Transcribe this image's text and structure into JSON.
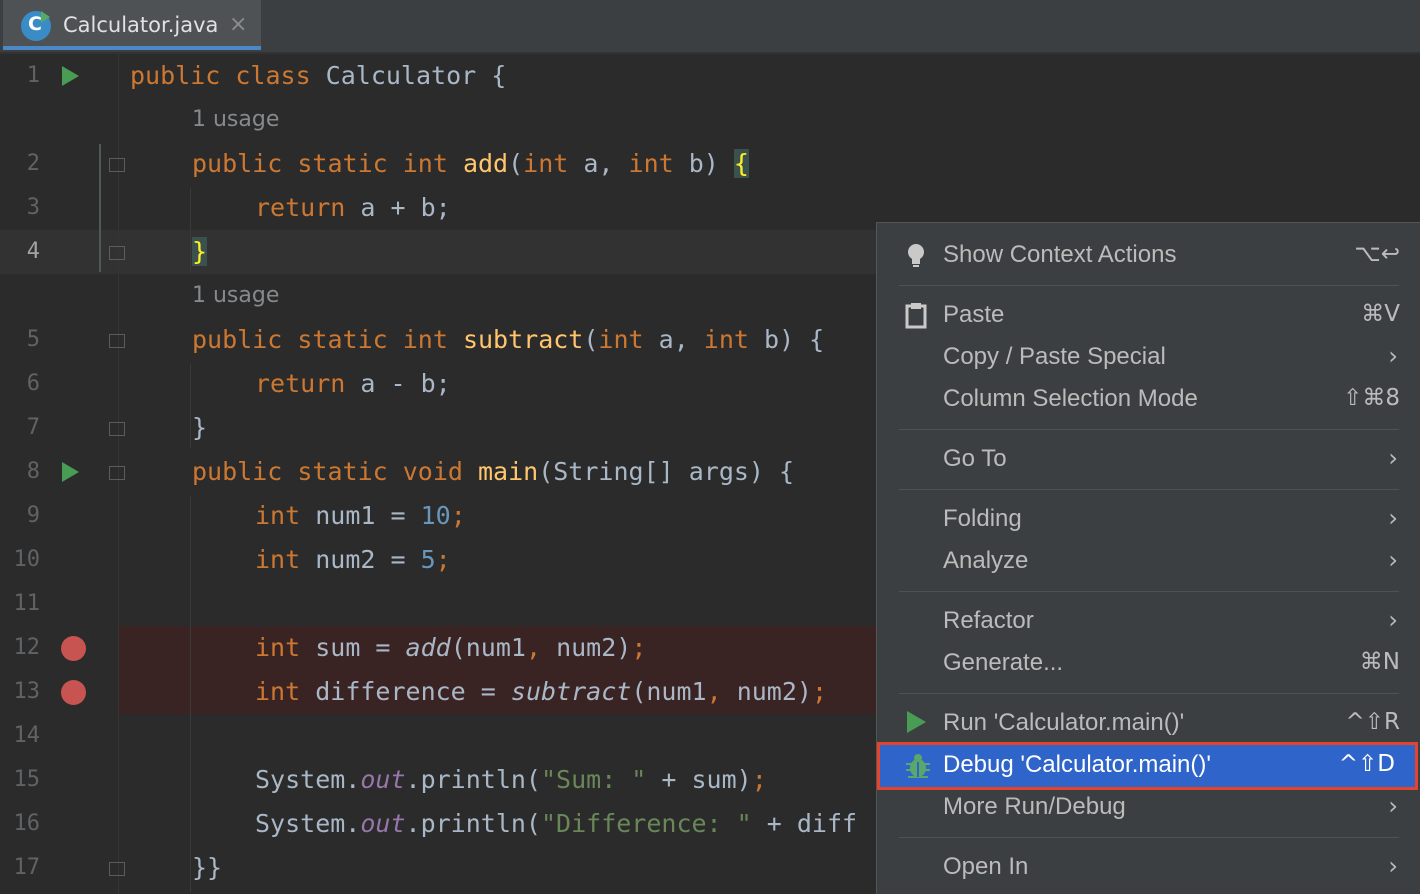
{
  "tab": {
    "title": "Calculator.java",
    "close": "×",
    "icon_letter": "C"
  },
  "usage_hint": "1 usage",
  "code_lines": [
    {
      "num": "1"
    },
    {
      "num": "2"
    },
    {
      "num": "3"
    },
    {
      "num": "4"
    },
    {
      "num": "5"
    },
    {
      "num": "6"
    },
    {
      "num": "7"
    },
    {
      "num": "8"
    },
    {
      "num": "9"
    },
    {
      "num": "10"
    },
    {
      "num": "11"
    },
    {
      "num": "12"
    },
    {
      "num": "13"
    },
    {
      "num": "14"
    },
    {
      "num": "15"
    },
    {
      "num": "16"
    },
    {
      "num": "17"
    }
  ],
  "code": {
    "l1": [
      "public",
      " class ",
      "Calculator {"
    ],
    "l2": [
      "public static int ",
      "add",
      "(",
      "int ",
      "a, ",
      "int ",
      "b) ",
      "{"
    ],
    "l3": [
      "return ",
      "a + b;"
    ],
    "l4": [
      "}"
    ],
    "l5": [
      "public static int ",
      "subtract",
      "(",
      "int ",
      "a, ",
      "int ",
      "b) {"
    ],
    "l6": [
      "return ",
      "a - b;"
    ],
    "l7": [
      "}"
    ],
    "l8": [
      "public static void ",
      "main",
      "(String[] args) {"
    ],
    "l9": [
      "int ",
      "num1 = ",
      "10",
      ";"
    ],
    "l10": [
      "int ",
      "num2 = ",
      "5",
      ";"
    ],
    "l12": [
      "int ",
      "sum = ",
      "add",
      "(num1",
      ", ",
      "num2)",
      ";"
    ],
    "l13": [
      "int ",
      "difference = ",
      "subtract",
      "(num1",
      ", ",
      "num2)",
      ";"
    ],
    "l15": [
      "System.",
      "out",
      ".println(",
      "\"Sum: \"",
      " + sum)",
      ";"
    ],
    "l16": [
      "System.",
      "out",
      ".println(",
      "\"Difference: \"",
      " + diff"
    ],
    "l17": [
      "}}"
    ]
  },
  "menu": {
    "items": [
      {
        "label": "Show Context Actions",
        "shortcut": "⌥↩",
        "icon": "lightbulb-icon"
      },
      {
        "label": "Paste",
        "shortcut": "⌘V",
        "icon": "clipboard-icon"
      },
      {
        "label": "Copy / Paste Special",
        "arrow": "›"
      },
      {
        "label": "Column Selection Mode",
        "shortcut": "⇧⌘8"
      },
      {
        "label": "Go To",
        "arrow": "›"
      },
      {
        "label": "Folding",
        "arrow": "›"
      },
      {
        "label": "Analyze",
        "arrow": "›"
      },
      {
        "label": "Refactor",
        "arrow": "›"
      },
      {
        "label": "Generate...",
        "shortcut": "⌘N"
      },
      {
        "label": "Run 'Calculator.main()'",
        "shortcut": "^⇧R",
        "icon": "run-icon"
      },
      {
        "label": "Debug 'Calculator.main()'",
        "shortcut": "^⇧D",
        "icon": "debug-icon"
      },
      {
        "label": "More Run/Debug",
        "arrow": "›"
      },
      {
        "label": "Open In",
        "arrow": "›"
      }
    ]
  },
  "colors": {
    "accent": "#2f65ca",
    "highlight_border": "#e5432b",
    "run_green": "#499c54",
    "breakpoint": "#c75450"
  }
}
